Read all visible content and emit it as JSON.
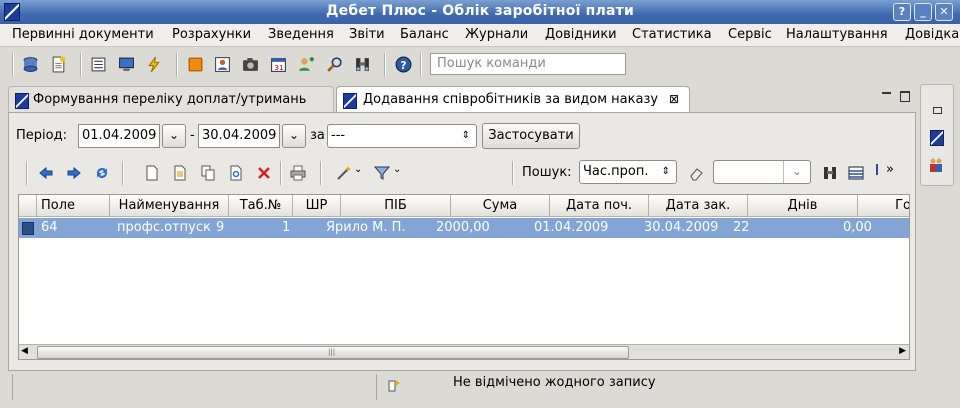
{
  "window": {
    "title": "Дебет Плюс - Облік заробітної плати"
  },
  "menu": [
    "Первинні документи",
    "Розрахунки",
    "Зведення",
    "Звіти",
    "Баланс",
    "Журнали",
    "Довідники",
    "Статистика",
    "Сервіс",
    "Налаштування",
    "Довідка"
  ],
  "command_search": {
    "placeholder": "Пошук команди"
  },
  "tabs": [
    {
      "label": "Формування переліку доплат/утримань",
      "active": false
    },
    {
      "label": "Додавання співробітників за видом наказу",
      "active": true,
      "close": "⊠"
    }
  ],
  "filter": {
    "period_label": "Період:",
    "date_from": "01.04.2009",
    "dash": "-",
    "date_to": "30.04.2009",
    "by_label": "за",
    "by_value": "---",
    "apply_label": "Застосувати"
  },
  "grid_search": {
    "label": "Пошук:",
    "field_value": "Час.проп.",
    "overflow": "»"
  },
  "table": {
    "columns": [
      "Поле",
      "Найменування",
      "Таб.№",
      "ШР",
      "ПІБ",
      "Сума",
      "Дата поч.",
      "Дата зак.",
      "Днів",
      "Год"
    ],
    "rows": [
      [
        "64",
        "профс.отпуск",
        "9",
        "1",
        "Ярило М. П.",
        "2000,00",
        "01.04.2009",
        "30.04.2009",
        "22",
        "0,00"
      ]
    ]
  },
  "status": {
    "text": "Не відмічено жодного запису"
  },
  "colors": {
    "title_bar": "#3f6ab0",
    "selection": "#82a5d6",
    "delete": "#d02020"
  }
}
